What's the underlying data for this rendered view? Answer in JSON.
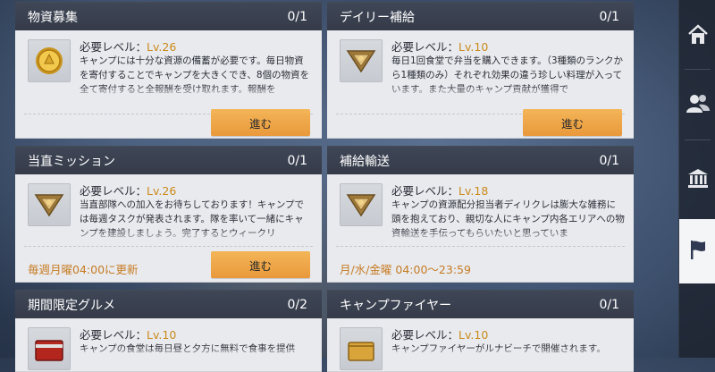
{
  "cards": [
    {
      "title": "物資募集",
      "progress": "0/1",
      "req_label": "必要レベル：",
      "level": "Lv.26",
      "icon": "gold-coin-icon",
      "desc": "キャンプには十分な資源の備蓄が必要です。毎日物資を寄付することでキャンプを大きくでき、8個の物資を全て寄付すると全報酬を受け取れます。報酬を",
      "button": "進む"
    },
    {
      "title": "デイリー補給",
      "progress": "0/1",
      "req_label": "必要レベル：",
      "level": "Lv.10",
      "icon": "supply-badge-icon",
      "desc": "毎日1回食堂で弁当を購入できます。（3種類のランクから1種類のみ）それぞれ効果の違う珍しい料理が入っています。また大量のキャンプ貢献が獲得で",
      "button": "進む"
    },
    {
      "title": "当直ミッション",
      "progress": "0/1",
      "req_label": "必要レベル：",
      "level": "Lv.26",
      "icon": "supply-badge-icon",
      "desc": "当直部隊への加入をお待ちしております！キャンプでは毎週タスクが発表されます。隊を率いて一緒にキャンプを建設しましょう。完了するとウィークリ",
      "footnote": "毎週月曜04:00に更新",
      "button": "進む"
    },
    {
      "title": "補給輸送",
      "progress": "0/1",
      "req_label": "必要レベル：",
      "level": "Lv.18",
      "icon": "supply-badge-icon",
      "desc": "キャンプの資源配分担当者ディリクレは膨大な雑務に頭を抱えており、親切な人にキャンプ内各エリアへの物資輸送を手伝ってもらいたいと思っていま",
      "footnote": "月/水/金曜 04:00～23:59"
    },
    {
      "title": "期間限定グルメ",
      "progress": "0/2",
      "req_label": "必要レベル：",
      "level": "Lv.10",
      "icon": "red-lunchbox-icon",
      "desc": "キャンプの食堂は毎日昼と夕方に無料で食事を提供"
    },
    {
      "title": "キャンプファイヤー",
      "progress": "0/1",
      "req_label": "必要レベル：",
      "level": "Lv.10",
      "icon": "gold-chest-icon",
      "desc": "キャンプファイヤーがルナビーチで開催されます。"
    }
  ],
  "sidebar": [
    {
      "icon": "home-icon",
      "active": false
    },
    {
      "icon": "members-icon",
      "active": false
    },
    {
      "icon": "building-icon",
      "active": false
    },
    {
      "icon": "flag-icon",
      "active": true
    }
  ],
  "colors": {
    "level": "#c98a1a",
    "button": "#eea548",
    "footnote": "#c67b22"
  }
}
